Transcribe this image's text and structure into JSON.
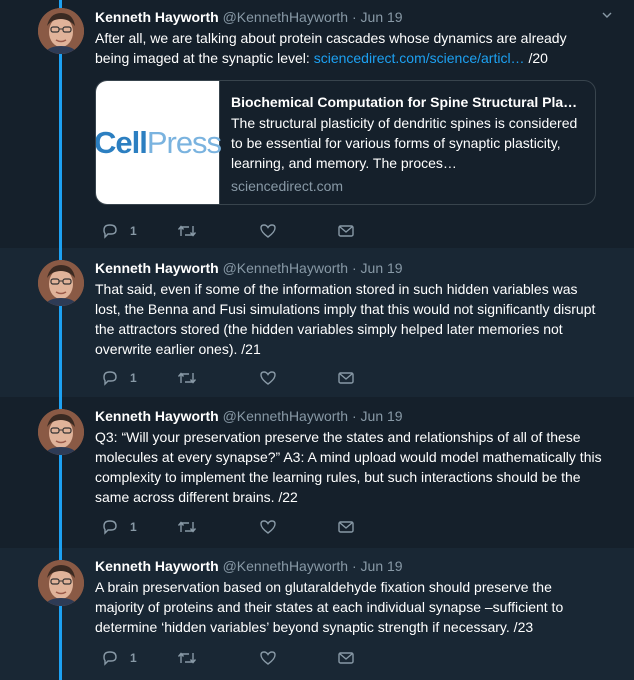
{
  "tweets": [
    {
      "name": "Kenneth Hayworth",
      "handle": "@KennethHayworth",
      "dot": "·",
      "date": "Jun 19",
      "text": "After all, we are talking about protein cascades whose dynamics are already being imaged at the synaptic level: ",
      "link": "sciencedirect.com/science/articl…",
      "text_after": " /20",
      "card": {
        "logo_a": "Cell",
        "logo_b": "Press",
        "title": "Biochemical Computation for Spine Structural Plas…",
        "description": "The structural plasticity of dendritic spines is considered to be essential for various forms of synaptic plasticity, learning, and memory. The proces…",
        "domain": "sciencedirect.com"
      },
      "reply_count": "1"
    },
    {
      "name": "Kenneth Hayworth",
      "handle": "@KennethHayworth",
      "dot": "·",
      "date": "Jun 19",
      "text": "That said, even if some of the information stored in such hidden variables was lost, the Benna and Fusi simulations imply that this would not significantly disrupt the attractors stored (the hidden variables simply helped later memories not overwrite earlier ones). /21",
      "reply_count": "1"
    },
    {
      "name": "Kenneth Hayworth",
      "handle": "@KennethHayworth",
      "dot": "·",
      "date": "Jun 19",
      "text": "Q3: “Will your preservation preserve the states and relationships of all of these molecules at every synapse?” A3: A mind upload would model mathematically this complexity to implement the learning rules, but such interactions should be the same across different brains. /22",
      "reply_count": "1"
    },
    {
      "name": "Kenneth Hayworth",
      "handle": "@KennethHayworth",
      "dot": "·",
      "date": "Jun 19",
      "text": "A brain preservation based on glutaraldehyde fixation should preserve the majority of proteins and their states at each individual synapse –sufficient to determine ‘hidden variables’ beyond synaptic strength if necessary. /23",
      "reply_count": "1"
    }
  ],
  "colors": {
    "background": "#15202b",
    "alt_background": "#192734",
    "accent": "#1da1f2",
    "muted": "#8899a6"
  },
  "icons": [
    "reply-icon",
    "retweet-icon",
    "like-icon",
    "direct-message-icon",
    "chevron-down-icon"
  ]
}
